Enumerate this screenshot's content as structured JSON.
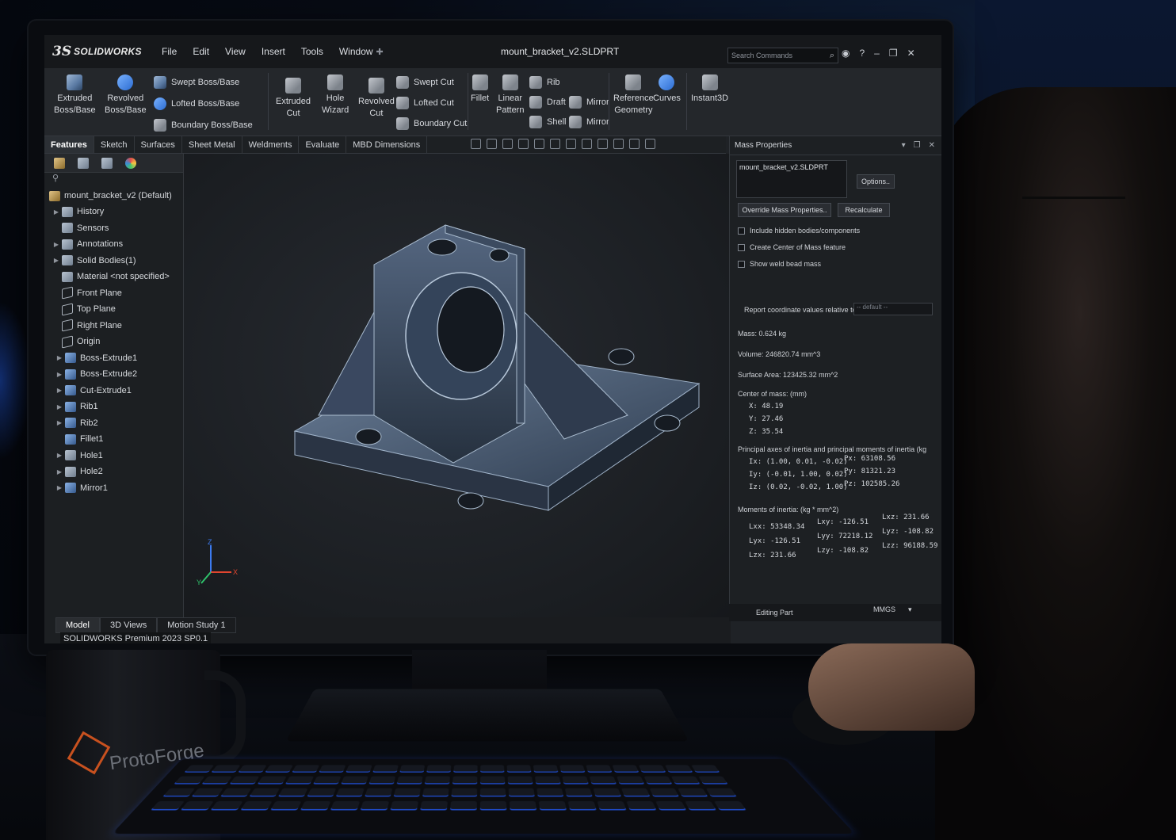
{
  "app": {
    "logo_mark": "3S",
    "logo_text": "SOLIDWORKS",
    "document_title": "mount_bracket_v2.SLDPRT",
    "search_placeholder": "Search Commands"
  },
  "menu": [
    "File",
    "Edit",
    "View",
    "Insert",
    "Tools",
    "Window"
  ],
  "ribbon": {
    "extruded_boss": "Extruded\nBoss/Base",
    "revolved_boss": "Revolved\nBoss/Base",
    "swept_boss": "Swept Boss/Base",
    "lofted_boss": "Lofted Boss/Base",
    "boundary_boss": "Boundary Boss/Base",
    "extruded_cut": "Extruded\nCut",
    "hole_wizard": "Hole\nWizard",
    "revolved_cut": "Revolved\nCut",
    "swept_cut": "Swept Cut",
    "lofted_cut": "Lofted Cut",
    "boundary_cut": "Boundary Cut",
    "fillet": "Fillet",
    "linear_pattern": "Linear\nPattern",
    "rib": "Rib",
    "draft": "Draft",
    "shell": "Shell",
    "mirror_1": "Mirror",
    "mirror_2": "Mirror",
    "reference_geometry": "Reference\nGeometry",
    "curves": "Curves",
    "instant3d": "Instant3D"
  },
  "tabs": [
    "Features",
    "Sketch",
    "Surfaces",
    "Sheet Metal",
    "Weldments",
    "Evaluate",
    "MBD Dimensions"
  ],
  "feature_tree": {
    "root": "mount_bracket_v2  (Default)",
    "items": [
      {
        "label": "History",
        "caret": true
      },
      {
        "label": "Sensors",
        "caret": false
      },
      {
        "label": "Annotations",
        "caret": true
      },
      {
        "label": "Solid Bodies(1)",
        "caret": true
      },
      {
        "label": "Material <not specified>",
        "caret": false
      },
      {
        "label": "Front Plane",
        "caret": false
      },
      {
        "label": "Top Plane",
        "caret": false
      },
      {
        "label": "Right Plane",
        "caret": false
      },
      {
        "label": "Origin",
        "caret": false
      },
      {
        "label": "Boss-Extrude1",
        "caret": true
      },
      {
        "label": "Boss-Extrude2",
        "caret": true
      },
      {
        "label": "Cut-Extrude1",
        "caret": true
      },
      {
        "label": "Rib1",
        "caret": true
      },
      {
        "label": "Rib2",
        "caret": true
      },
      {
        "label": "Fillet1",
        "caret": false
      },
      {
        "label": "Hole1",
        "caret": true
      },
      {
        "label": "Hole2",
        "caret": true
      },
      {
        "label": "Mirror1",
        "caret": true
      }
    ]
  },
  "bottom_tabs": [
    "Model",
    "3D Views",
    "Motion Study 1"
  ],
  "version": "SOLIDWORKS Premium 2023 SP0.1",
  "mass_properties": {
    "title": "Mass Properties",
    "file": "mount_bracket_v2.SLDPRT",
    "options_btn": "Options..",
    "override_btn": "Override Mass Properties..",
    "recalculate_btn": "Recalculate",
    "check_hidden": "Include hidden bodies/components",
    "check_com": "Create Center of Mass feature",
    "check_weld": "Show weld bead mass",
    "report_relative": "Report coordinate values relative to:",
    "report_default": "-- default --",
    "mass": "Mass:  0.624 kg",
    "volume": "Volume:  246820.74 mm^3",
    "surface_area": "Surface Area:  123425.32 mm^2",
    "com_label": "Center of mass:  (mm)",
    "com_x": "X:  48.19",
    "com_y": "Y:  27.46",
    "com_z": "Z:  35.54",
    "principal_label": "Principal axes of inertia and principal moments of inertia (kg",
    "ix": "Ix:  (1.00, 0.01, -0.02)",
    "iy": "Iy:  (-0.01, 1.00, 0.02)",
    "iz": "Iz:  (0.02, -0.02, 1.00)",
    "px": "Px:  63108.56",
    "py": "Py:  81321.23",
    "pz": "Pz:  102585.26",
    "moments_label": "Moments of inertia:  (kg * mm^2)",
    "lxx": "Lxx:  53348.34",
    "lyx": "Lyx:  -126.51",
    "lzx": "Lzx:  231.66",
    "lxy": "Lxy:  -126.51",
    "lyy": "Lyy:  72218.12",
    "lzy": "Lzy:  -108.82",
    "lxz": "Lxz:  231.66",
    "lyz": "Lyz:  -108.82",
    "lzz": "Lzz:  96188.59"
  },
  "status": {
    "mode": "Editing Part",
    "units": "MMGS"
  },
  "mug": {
    "brand": "ProtoForge"
  },
  "icons": [
    "search-icon",
    "help-icon",
    "minimize-icon",
    "maximize-icon",
    "close-icon",
    "pin-icon",
    "triad-icon"
  ]
}
